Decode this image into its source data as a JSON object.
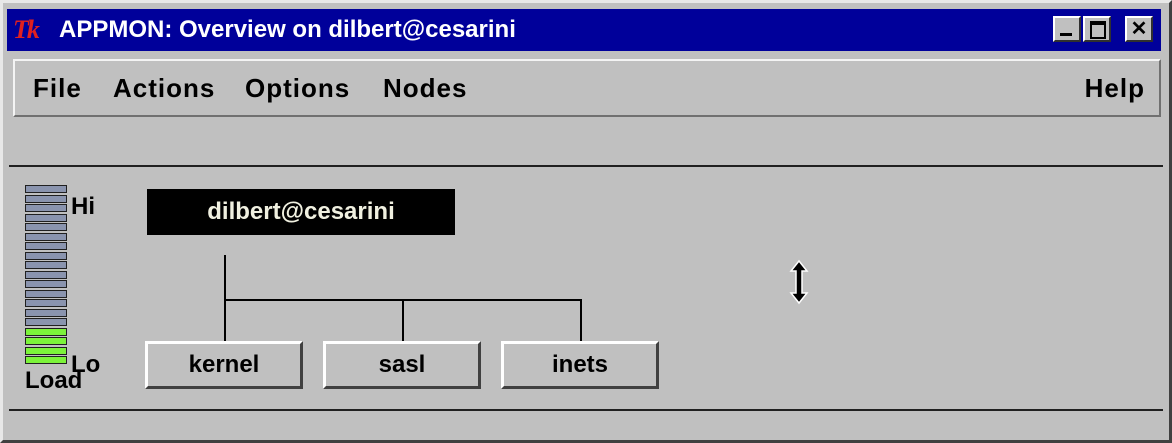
{
  "window": {
    "title": "APPMON: Overview on dilbert@cesarini",
    "logo_text": "Tk",
    "controls": {
      "minimize": "minimize-icon",
      "maximize": "maximize-icon",
      "close": "✕"
    }
  },
  "menubar": {
    "items": [
      "File",
      "Actions",
      "Options",
      "Nodes"
    ],
    "help": "Help"
  },
  "load_meter": {
    "hi_label": "Hi",
    "lo_label": "Lo",
    "label": "Load",
    "segments_total": 19,
    "segments_active": 4,
    "colors": {
      "inactive": "#8a94ae",
      "active": "#7cf33a"
    }
  },
  "node": {
    "name": "dilbert@cesarini"
  },
  "applications": [
    {
      "name": "kernel"
    },
    {
      "name": "sasl"
    },
    {
      "name": "inets"
    }
  ],
  "cursor": "resize-vertical-cursor-icon",
  "colors": {
    "titlebar": "#00009a",
    "background": "#c0c0c0"
  }
}
